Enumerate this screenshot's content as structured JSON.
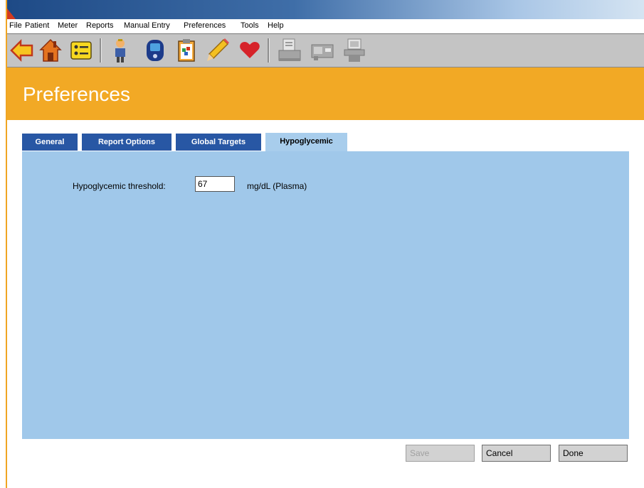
{
  "menu": [
    "File",
    "Patient",
    "Meter",
    "Reports",
    "Manual Entry",
    "Preferences",
    "Tools",
    "Help"
  ],
  "toolbar": {
    "icons": [
      "back-arrow-icon",
      "home-icon",
      "list-icon",
      "doctor-icon",
      "meter-icon",
      "clipboard-icon",
      "pencil-icon",
      "heart-icon",
      "printer-icon",
      "card-reader-icon",
      "computer-icon"
    ]
  },
  "header": {
    "title": "Preferences"
  },
  "tabs": [
    {
      "label": "General",
      "active": false
    },
    {
      "label": "Report Options",
      "active": false
    },
    {
      "label": "Global Targets",
      "active": false
    },
    {
      "label": "Hypoglycemic",
      "active": true
    }
  ],
  "form": {
    "threshold_label": "Hypoglycemic threshold:",
    "threshold_value": "67",
    "unit": "mg/dL (Plasma)"
  },
  "buttons": {
    "save": "Save",
    "cancel": "Cancel",
    "done": "Done"
  },
  "colors": {
    "header": "#f2a925",
    "panel": "#a0c8ea",
    "tab": "#2857a4"
  }
}
